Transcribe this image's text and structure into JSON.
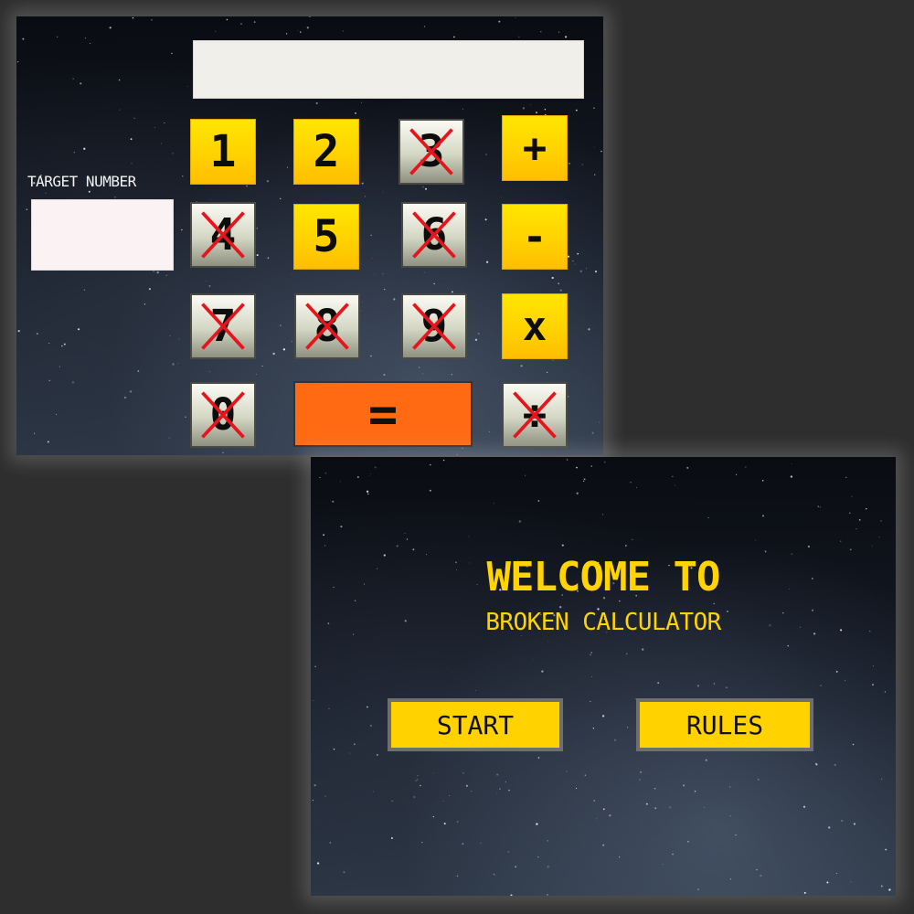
{
  "calculator": {
    "display_value": "",
    "target_label": "TARGET NUMBER",
    "target_value": "",
    "keys": {
      "k1": "1",
      "k2": "2",
      "k3": "3",
      "k4": "4",
      "k5": "5",
      "k6": "6",
      "k7": "7",
      "k8": "8",
      "k9": "9",
      "k0": "0",
      "plus": "+",
      "minus": "-",
      "times": "x",
      "divide": "÷",
      "equals": "="
    },
    "disabled_keys": [
      "3",
      "4",
      "6",
      "7",
      "8",
      "9",
      "0",
      "÷"
    ],
    "colors": {
      "active_key": "#ffd200",
      "disabled_key": "#d4d6c4",
      "strike": "#e8141c",
      "equals_key": "#ff6a12"
    }
  },
  "welcome": {
    "title": "WELCOME TO",
    "subtitle": "BROKEN CALCULATOR",
    "start_label": "START",
    "rules_label": "RULES",
    "accent": "#ffd400"
  }
}
